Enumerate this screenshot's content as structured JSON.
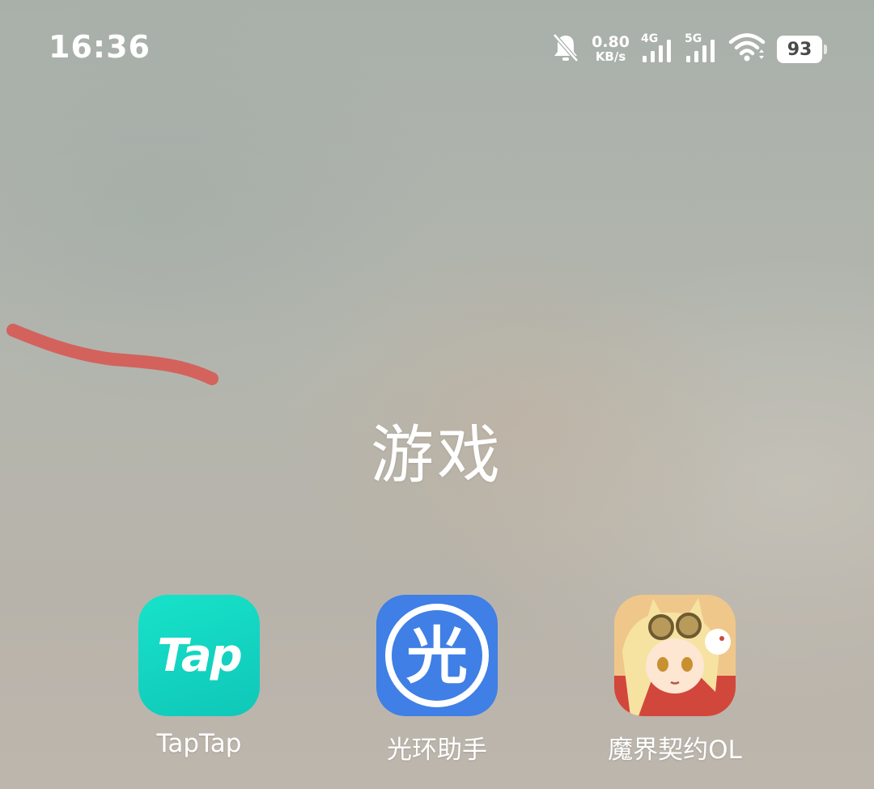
{
  "status_bar": {
    "time": "16:36",
    "net_speed_value": "0.80",
    "net_speed_unit": "KB/s",
    "signal_1_tech": "4G",
    "signal_2_tech": "5G",
    "battery_level": "93",
    "icons": [
      "bell-muted-icon",
      "signal-icon",
      "signal-icon",
      "wifi-icon",
      "battery-icon"
    ]
  },
  "folder": {
    "title": "游戏"
  },
  "apps": [
    {
      "label": "TapTap",
      "icon_text": "Tap",
      "color": "#15DCC4"
    },
    {
      "label": "光环助手",
      "icon_text": "光",
      "color": "#3F7FE6"
    },
    {
      "label": "魔界契约OL",
      "color": "#E9B66F"
    }
  ],
  "annotation": {
    "color": "#D9534F"
  }
}
